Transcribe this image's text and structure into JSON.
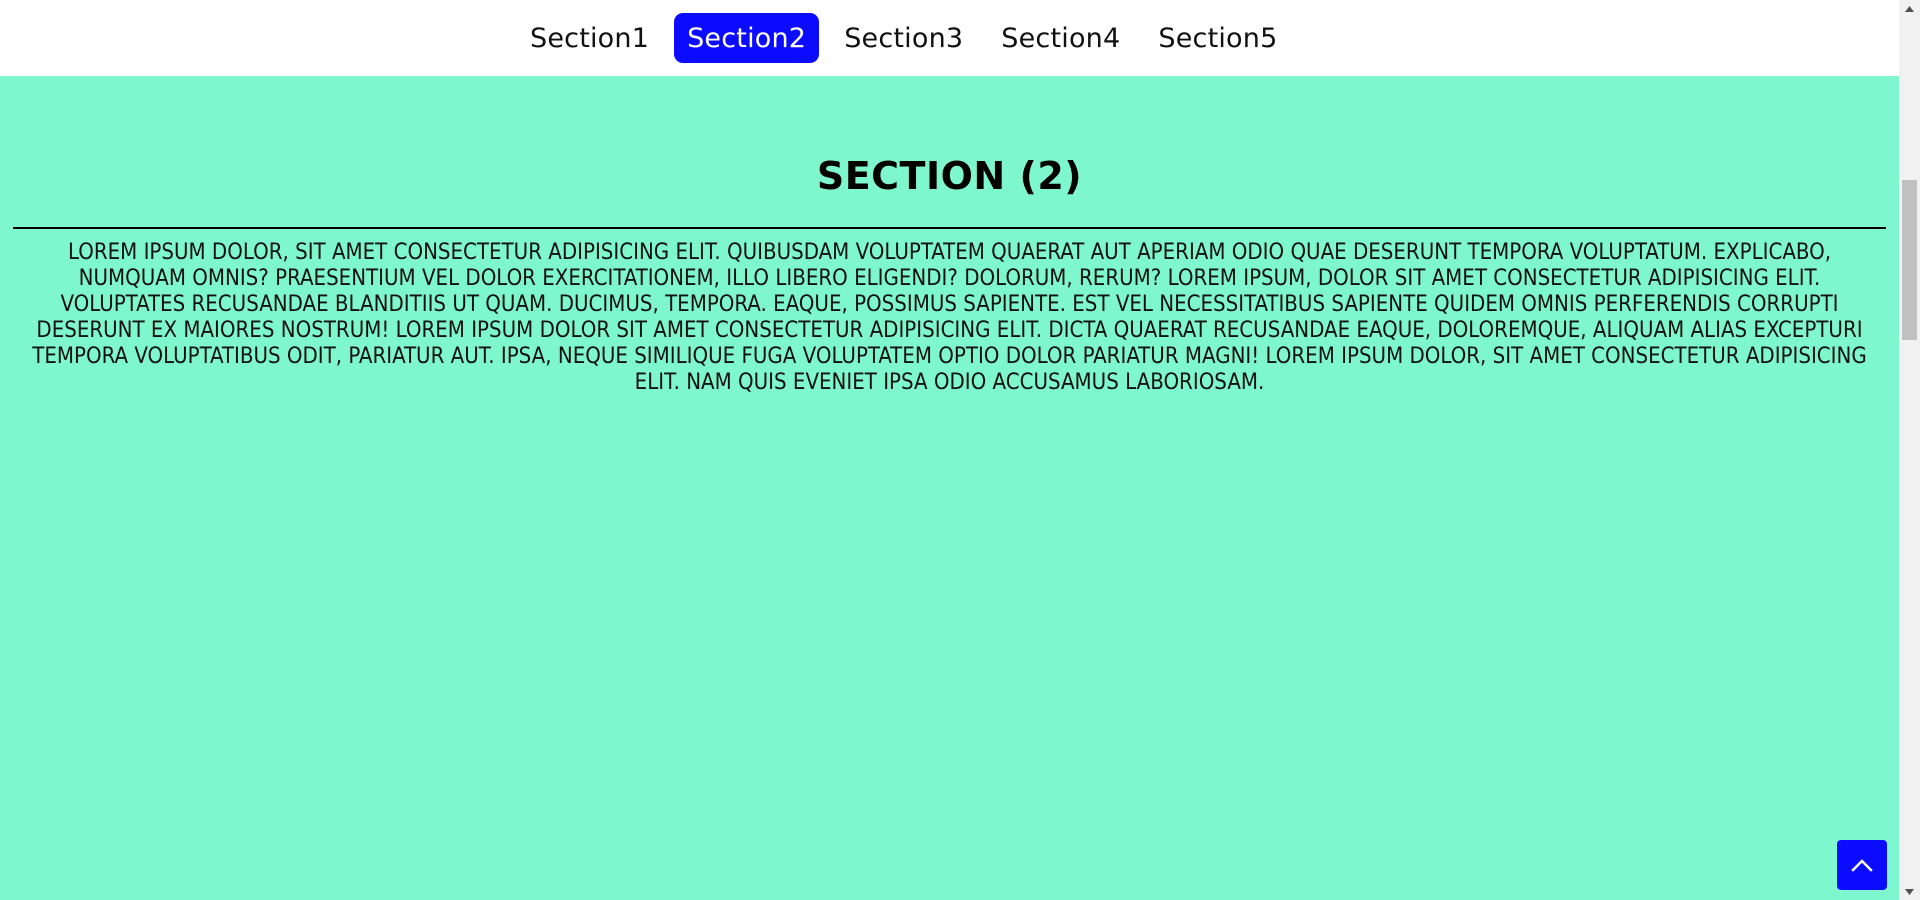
{
  "nav": {
    "items": [
      {
        "label": "Section1",
        "active": false
      },
      {
        "label": "Section2",
        "active": true
      },
      {
        "label": "Section3",
        "active": false
      },
      {
        "label": "Section4",
        "active": false
      },
      {
        "label": "Section5",
        "active": false
      }
    ]
  },
  "section": {
    "title": "SECTION (2)",
    "text": "LOREM IPSUM DOLOR, SIT AMET CONSECTETUR ADIPISICING ELIT. QUIBUSDAM VOLUPTATEM QUAERAT AUT APERIAM ODIO QUAE DESERUNT TEMPORA VOLUPTATUM. EXPLICABO, NUMQUAM OMNIS? PRAESENTIUM VEL DOLOR EXERCITATIONEM, ILLO LIBERO ELIGENDI? DOLORUM, RERUM? LOREM IPSUM, DOLOR SIT AMET CONSECTETUR ADIPISICING ELIT. VOLUPTATES RECUSANDAE BLANDITIIS UT QUAM. DUCIMUS, TEMPORA. EAQUE, POSSIMUS SAPIENTE. EST VEL NECESSITATIBUS SAPIENTE QUIDEM OMNIS PERFERENDIS CORRUPTI DESERUNT EX MAIORES NOSTRUM! LOREM IPSUM DOLOR SIT AMET CONSECTETUR ADIPISICING ELIT. DICTA QUAERAT RECUSANDAE EAQUE, DOLOREMQUE, ALIQUAM ALIAS EXCEPTURI TEMPORA VOLUPTATIBUS ODIT, PARIATUR AUT. IPSA, NEQUE SIMILIQUE FUGA VOLUPTATEM OPTIO DOLOR PARIATUR MAGNI! LOREM IPSUM DOLOR, SIT AMET CONSECTETUR ADIPISICING ELIT. NAM QUIS EVENIET IPSA ODIO ACCUSAMUS LABORIOSAM."
  },
  "icons": {
    "back_to_top": "chevron-up-icon",
    "scroll_up": "scroll-up-arrow-icon",
    "scroll_down": "scroll-down-arrow-icon"
  },
  "colors": {
    "background": "#7ef7cf",
    "navbar": "#ffffff",
    "active_nav": "#0b0bff",
    "button": "#0b0bff",
    "text": "#111111"
  }
}
